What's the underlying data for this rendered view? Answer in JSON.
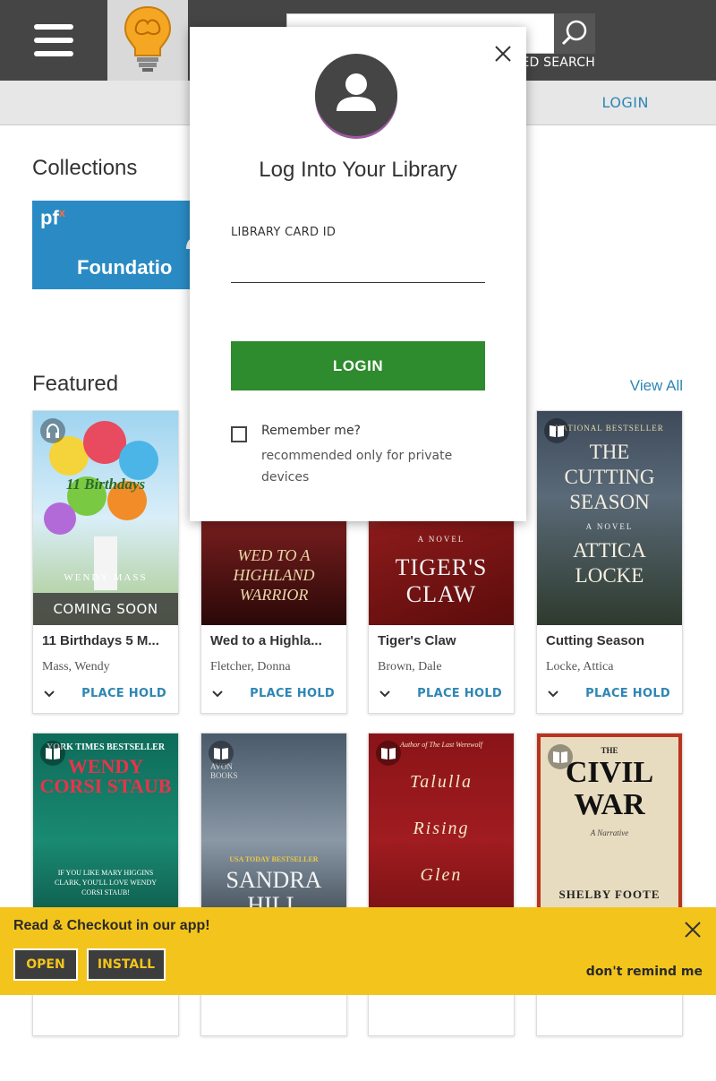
{
  "header": {
    "advanced_search_label": "ED SEARCH",
    "nav_login": "LOGIN",
    "search_placeholder": ""
  },
  "collections": {
    "title": "Collections",
    "tile_brand": "pf",
    "tile_brand_mark": "x",
    "tile_label": "Foundatio"
  },
  "featured": {
    "title": "Featured",
    "view_all": "View All",
    "books": [
      {
        "title": "11 Birthdays 5 M...",
        "author": "Mass, Wendy",
        "action": "PLACE HOLD",
        "badge": "COMING SOON",
        "cover_title": "11 Birthdays",
        "cover_author": "WENDY MASS",
        "format": "audiobook-icon"
      },
      {
        "title": "Wed to a Highla...",
        "author": "Fletcher, Donna",
        "action": "PLACE HOLD",
        "cover_title": "WED TO A HIGHLAND WARRIOR",
        "format": "book-icon"
      },
      {
        "title": "Tiger's Claw",
        "author": "Brown, Dale",
        "action": "PLACE HOLD",
        "cover_title": "TIGER'S CLAW",
        "cover_sub": "A NOVEL",
        "format": "book-icon"
      },
      {
        "title": "Cutting Season",
        "author": "Locke, Attica",
        "action": "PLACE HOLD",
        "cover_top": "NATIONAL BESTSELLER",
        "cover_title": "THE CUTTING SEASON",
        "cover_sub": "A NOVEL",
        "cover_author": "ATTICA LOCKE",
        "format": "book-icon"
      },
      {
        "cover_top": "YORK TIMES BESTSELLER",
        "cover_title": "WENDY CORSI STAUB",
        "cover_blurb": "IF YOU LIKE MARY HIGGINS CLARK, YOU'LL LOVE WENDY CORSI STAUB!",
        "format": "book-icon"
      },
      {
        "cover_top": "AVON BOOKS",
        "cover_title": "SANDRA HILL",
        "cover_blurb": "USA TODAY BESTSELLER",
        "format": "book-icon"
      },
      {
        "cover_top": "Author of The Last Werewolf",
        "cover_title": "Talulla Rising",
        "cover_author": "Glen Duncan",
        "format": "book-icon"
      },
      {
        "cover_top": "THE",
        "cover_title": "CIVIL WAR",
        "cover_sub": "A Narrative",
        "cover_author": "SHELBY FOOTE",
        "format": "book-icon"
      }
    ]
  },
  "login_modal": {
    "title": "Log Into Your Library",
    "field_label": "LIBRARY CARD ID",
    "field_value": "",
    "login_button": "LOGIN",
    "remember_label": "Remember me?",
    "remember_note": "recommended only for private devices",
    "remember_checked": false
  },
  "app_banner": {
    "text": "Read & Checkout in our app!",
    "open_button": "OPEN",
    "install_button": "INSTALL",
    "dont_remind": "don't remind me"
  },
  "colors": {
    "header_bg": "#454545",
    "accent_blue": "#2e86b4",
    "login_green": "#2e8b2e",
    "banner_yellow": "#f3c51c"
  }
}
